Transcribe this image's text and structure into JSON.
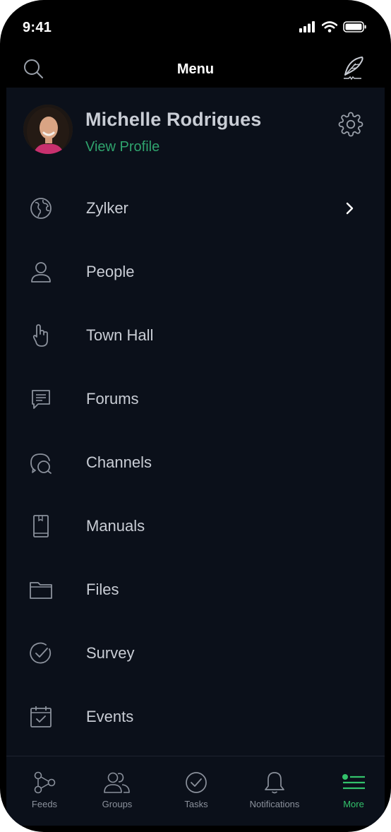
{
  "status_bar": {
    "time": "9:41"
  },
  "header": {
    "title": "Menu"
  },
  "profile": {
    "name": "Michelle Rodrigues",
    "link": "View Profile"
  },
  "menu": {
    "items": [
      {
        "label": "Zylker",
        "icon": "globe-icon"
      },
      {
        "label": "People",
        "icon": "person-icon"
      },
      {
        "label": "Town Hall",
        "icon": "raised-hand-icon"
      },
      {
        "label": "Forums",
        "icon": "chat-bubble-icon"
      },
      {
        "label": "Channels",
        "icon": "channels-icon"
      },
      {
        "label": "Manuals",
        "icon": "book-icon"
      },
      {
        "label": "Files",
        "icon": "folder-icon"
      },
      {
        "label": "Survey",
        "icon": "check-circle-icon"
      },
      {
        "label": "Events",
        "icon": "calendar-icon"
      }
    ]
  },
  "tabbar": {
    "tabs": [
      {
        "label": "Feeds",
        "icon": "feeds-icon"
      },
      {
        "label": "Groups",
        "icon": "groups-icon"
      },
      {
        "label": "Tasks",
        "icon": "tasks-icon"
      },
      {
        "label": "Notifications",
        "icon": "bell-icon"
      },
      {
        "label": "More",
        "icon": "more-icon",
        "active": true
      }
    ]
  },
  "colors": {
    "background": "#0b101a",
    "text": "#c9cdd5",
    "accent": "#33c26b",
    "link": "#2fa36d",
    "icon": "#8b919c"
  }
}
